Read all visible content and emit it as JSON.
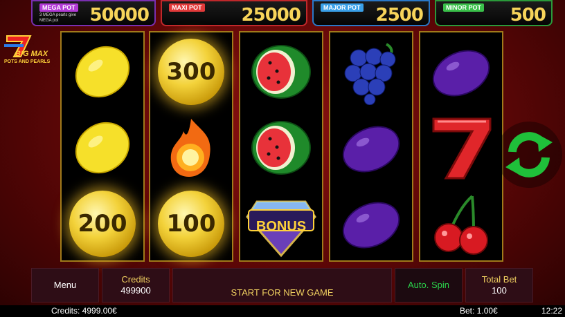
{
  "pots": [
    {
      "label": "MEGA POT",
      "value": "50000",
      "sub": "3 MEGA pearls give MEGA pot",
      "color": "#7a2fb0",
      "labelBg": "#b23ad6"
    },
    {
      "label": "MAXI POT",
      "value": "25000",
      "sub": "",
      "color": "#c0282b",
      "labelBg": "#e23a3a"
    },
    {
      "label": "MAJOR POT",
      "value": "2500",
      "sub": "",
      "color": "#2a78c8",
      "labelBg": "#3aa0e8"
    },
    {
      "label": "MINOR POT",
      "value": "500",
      "sub": "",
      "color": "#2a9a3a",
      "labelBg": "#3ac04a"
    }
  ],
  "logo": {
    "line1": "BIG MAX",
    "line2": "POTS AND PEARLS"
  },
  "reels": [
    [
      "lemon",
      "lemon",
      "coin-200"
    ],
    [
      "coin-300",
      "fireball",
      "coin-100"
    ],
    [
      "watermelon",
      "watermelon",
      "bonus-diamond"
    ],
    [
      "grapes",
      "plum",
      "plum"
    ],
    [
      "plum",
      "seven",
      "cherries"
    ]
  ],
  "coins": {
    "c300": "300",
    "c200": "200",
    "c100": "100"
  },
  "bonus_text": "BONUS",
  "controls": {
    "menu": "Menu",
    "credits_label": "Credits",
    "credits_value": "499900",
    "start": "START FOR NEW GAME",
    "autospin": "Auto. Spin",
    "totalbet_label": "Total Bet",
    "totalbet_value": "100"
  },
  "status": {
    "credits": "Credits: 4999.00€",
    "bet": "Bet: 1.00€",
    "time": "12:22"
  },
  "colors": {
    "gold": "#f0d060",
    "spin_green": "#1fc03a"
  }
}
